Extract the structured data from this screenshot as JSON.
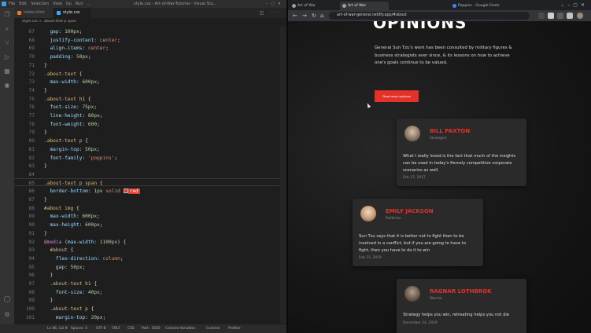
{
  "vscode": {
    "menus": [
      "File",
      "Edit",
      "Selection",
      "View",
      "Go",
      "Run",
      "..."
    ],
    "window_title": "style.css - Art-of-War-Tutorial - Visual Stu...",
    "tabs": [
      {
        "label": "index.html",
        "active": false,
        "color": "#e37933"
      },
      {
        "label": "style.css",
        "active": true,
        "color": "#42a5f5"
      }
    ],
    "breadcrumb": "style.css > .about-text p span",
    "lines": [
      {
        "n": "67",
        "segs": [
          [
            "prop",
            "  gap"
          ],
          [
            "brace",
            ": "
          ],
          [
            "num",
            "100px"
          ],
          [
            "brace",
            ";"
          ]
        ]
      },
      {
        "n": "68",
        "segs": [
          [
            "prop",
            "  justify-content"
          ],
          [
            "brace",
            ": "
          ],
          [
            "val",
            "center"
          ],
          [
            "brace",
            ";"
          ]
        ]
      },
      {
        "n": "69",
        "segs": [
          [
            "prop",
            "  align-items"
          ],
          [
            "brace",
            ": "
          ],
          [
            "val",
            "center"
          ],
          [
            "brace",
            ";"
          ]
        ]
      },
      {
        "n": "70",
        "segs": [
          [
            "prop",
            "  padding"
          ],
          [
            "brace",
            ": "
          ],
          [
            "num",
            "50px"
          ],
          [
            "brace",
            ";"
          ]
        ]
      },
      {
        "n": "71",
        "segs": [
          [
            "brace",
            "}"
          ]
        ]
      },
      {
        "n": "72",
        "segs": [
          [
            "sel",
            ".about-text"
          ],
          [
            "brace",
            " {"
          ]
        ]
      },
      {
        "n": "73",
        "segs": [
          [
            "prop",
            "  max-width"
          ],
          [
            "brace",
            ": "
          ],
          [
            "num",
            "600px"
          ],
          [
            "brace",
            ";"
          ]
        ]
      },
      {
        "n": "74",
        "segs": [
          [
            "brace",
            "}"
          ]
        ]
      },
      {
        "n": "75",
        "segs": [
          [
            "sel",
            ".about-text h1"
          ],
          [
            "brace",
            " {"
          ]
        ]
      },
      {
        "n": "76",
        "segs": [
          [
            "prop",
            "  font-size"
          ],
          [
            "brace",
            ": "
          ],
          [
            "num",
            "75px"
          ],
          [
            "brace",
            ";"
          ]
        ]
      },
      {
        "n": "77",
        "segs": [
          [
            "prop",
            "  line-height"
          ],
          [
            "brace",
            ": "
          ],
          [
            "num",
            "80px"
          ],
          [
            "brace",
            ";"
          ]
        ]
      },
      {
        "n": "78",
        "segs": [
          [
            "prop",
            "  font-weight"
          ],
          [
            "brace",
            ": "
          ],
          [
            "num",
            "600"
          ],
          [
            "brace",
            ";"
          ]
        ]
      },
      {
        "n": "79",
        "segs": [
          [
            "brace",
            "}"
          ]
        ]
      },
      {
        "n": "80",
        "segs": [
          [
            "sel",
            ".about-text p"
          ],
          [
            "brace",
            " {"
          ]
        ]
      },
      {
        "n": "81",
        "segs": [
          [
            "prop",
            "  margin-top"
          ],
          [
            "brace",
            ": "
          ],
          [
            "num",
            "50px"
          ],
          [
            "brace",
            ";"
          ]
        ]
      },
      {
        "n": "82",
        "segs": [
          [
            "prop",
            "  font-family"
          ],
          [
            "brace",
            ": "
          ],
          [
            "val",
            "'poppins'"
          ],
          [
            "brace",
            ";"
          ]
        ]
      },
      {
        "n": "83",
        "segs": [
          [
            "brace",
            "}"
          ]
        ]
      },
      {
        "n": "84",
        "segs": [
          [
            "brace",
            ""
          ]
        ]
      },
      {
        "n": "85",
        "segs": [
          [
            "sel",
            ".about-text p span"
          ],
          [
            "brace",
            " {"
          ]
        ]
      },
      {
        "n": "86",
        "segs": [
          [
            "prop",
            "  border-bottom"
          ],
          [
            "brace",
            ": "
          ],
          [
            "num",
            "1px"
          ],
          [
            "val",
            " solid "
          ],
          [
            "swatch",
            ""
          ],
          [
            "redval",
            "red"
          ]
        ]
      },
      {
        "n": "87",
        "segs": [
          [
            "brace",
            "}"
          ]
        ]
      },
      {
        "n": "88",
        "segs": [
          [
            "sel",
            "#about img"
          ],
          [
            "brace",
            " {"
          ]
        ]
      },
      {
        "n": "89",
        "segs": [
          [
            "prop",
            "  max-width"
          ],
          [
            "brace",
            ": "
          ],
          [
            "num",
            "600px"
          ],
          [
            "brace",
            ";"
          ]
        ]
      },
      {
        "n": "90",
        "segs": [
          [
            "prop",
            "  max-height"
          ],
          [
            "brace",
            ": "
          ],
          [
            "num",
            "600px"
          ],
          [
            "brace",
            ";"
          ]
        ]
      },
      {
        "n": "91",
        "segs": [
          [
            "brace",
            "}"
          ]
        ]
      },
      {
        "n": "92",
        "segs": [
          [
            "kw",
            "@media"
          ],
          [
            "brace",
            " ("
          ],
          [
            "prop",
            "max-width"
          ],
          [
            "brace",
            ": "
          ],
          [
            "num",
            "1100px"
          ],
          [
            "brace",
            ") {"
          ]
        ]
      },
      {
        "n": "93",
        "segs": [
          [
            "sel",
            "  #about"
          ],
          [
            "brace",
            " {"
          ]
        ]
      },
      {
        "n": "94",
        "segs": [
          [
            "prop",
            "    flex-direction"
          ],
          [
            "brace",
            ": "
          ],
          [
            "val",
            "column"
          ],
          [
            "brace",
            ";"
          ]
        ]
      },
      {
        "n": "95",
        "segs": [
          [
            "prop",
            "    gap"
          ],
          [
            "brace",
            ": "
          ],
          [
            "num",
            "50px"
          ],
          [
            "brace",
            ";"
          ]
        ]
      },
      {
        "n": "96",
        "segs": [
          [
            "brace",
            "  }"
          ]
        ]
      },
      {
        "n": "97",
        "segs": [
          [
            "sel",
            "  .about-text h1"
          ],
          [
            "brace",
            " {"
          ]
        ]
      },
      {
        "n": "98",
        "segs": [
          [
            "prop",
            "    font-size"
          ],
          [
            "brace",
            ": "
          ],
          [
            "num",
            "40px"
          ],
          [
            "brace",
            ";"
          ]
        ]
      },
      {
        "n": "99",
        "segs": [
          [
            "brace",
            "  }"
          ]
        ]
      },
      {
        "n": "100",
        "segs": [
          [
            "sel",
            "  .about-text p"
          ],
          [
            "brace",
            " {"
          ]
        ]
      },
      {
        "n": "101",
        "segs": [
          [
            "prop",
            "    margin-top"
          ],
          [
            "brace",
            ": "
          ],
          [
            "num",
            "20px"
          ],
          [
            "brace",
            ";"
          ]
        ]
      },
      {
        "n": "102",
        "segs": [
          [
            "brace",
            "  }"
          ]
        ]
      }
    ],
    "status": [
      "Ln 86, Col 8",
      "Spaces: 4",
      "UTF-8",
      "CRLF",
      "CSS",
      "Port : 5500",
      "Colorize Variables",
      "Colorize",
      "Prettier"
    ]
  },
  "browser": {
    "tabs": [
      {
        "label": "Art of War",
        "active": false,
        "color": "#9e9e9e"
      },
      {
        "label": "Art of War",
        "active": true,
        "color": "#9e9e9e"
      },
      {
        "label": "Poppins - Google Fonts",
        "active": false,
        "color": "#4285f4"
      }
    ],
    "url": "art-of-war-general.netlify.app/#about"
  },
  "page": {
    "heading": "OPINIONS",
    "paragraph": "General Sun Tzu's work has been consulted by military figures & business strategists ever since, & its lessons on how to achieve one's goals continue to be valued.",
    "button_label": "Read more opinions",
    "cards": [
      {
        "name": "BILL PAXTON",
        "role": "Strategist",
        "quote": "What I really loved is the fact that much of the insights can be used in today's fiercely competitive corporate scenarios as well.",
        "date": "Feb 17, 2017"
      },
      {
        "name": "EMILY JACKSON",
        "role": "Politician",
        "quote": "Sun Tzu says that it is better not to fight than to be involved in a conflict, but if you are going to have to fight, then you have to do it to win",
        "date": "Feb 21, 2019"
      },
      {
        "name": "RAGNAR LOTHBROK",
        "role": "Warrior",
        "quote": "Strategy helps you win, retreating helps you not die",
        "date": "December 24, 2019"
      }
    ]
  },
  "colors": {
    "accent": "#e4322a",
    "editor_bg": "#1e1e1e"
  }
}
